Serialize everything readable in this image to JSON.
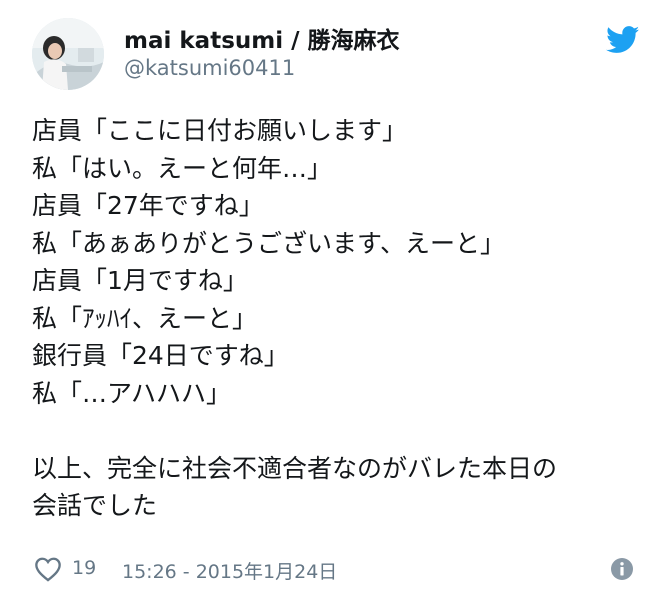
{
  "user": {
    "display_name": "mai katsumi / 勝海麻衣",
    "handle": "@katsumi60411",
    "avatar_icon": "profile-photo"
  },
  "brand": {
    "icon": "twitter-bird-icon",
    "color": "#1da1f2"
  },
  "tweet": {
    "lines": [
      "店員「ここに日付お願いします」",
      "私「はい。えーと何年…」",
      "店員「27年ですね」",
      "私「あぁありがとうございます、えーと」",
      "店員「1月ですね」",
      "私「ｱｯﾊｲ、えーと」",
      "銀行員「24日ですね」",
      "私「…アハハハ」",
      "",
      "以上、完全に社会不適合者なのがバレた本日の",
      "会話でした"
    ]
  },
  "footer": {
    "like_icon": "heart-icon",
    "like_count": "19",
    "timestamp": "15:26 - 2015年1月24日",
    "info_icon": "info-icon"
  }
}
